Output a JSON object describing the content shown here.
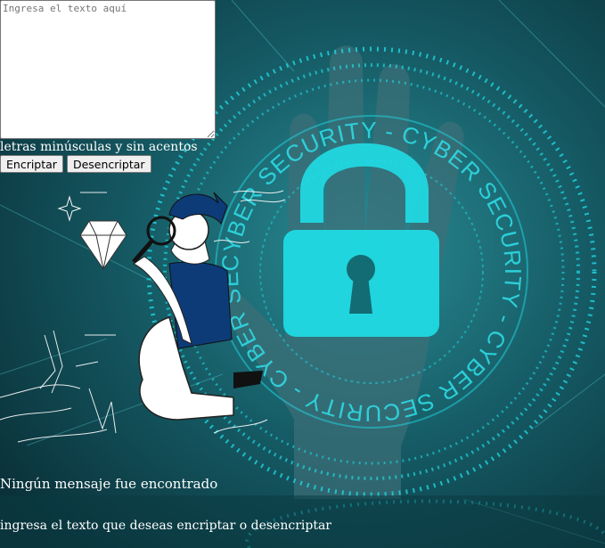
{
  "input": {
    "placeholder": "Ingresa el texto aquí",
    "value": ""
  },
  "hint": "letras minúsculas y sin acentos",
  "buttons": {
    "encrypt": "Encriptar",
    "decrypt": "Desencriptar"
  },
  "output": {
    "no_message_title": "Ningún mensaje fue encontrado",
    "instruction": "ingresa el texto que deseas encriptar o desencriptar"
  },
  "background": {
    "ring_text": "CYBER SECURITY - CYBER SECURITY - CYBER SECURITY - CYBER SECURITY -"
  },
  "colors": {
    "bg_dark": "#0d3f48",
    "accent_cyan": "#19d6df",
    "figure_blue": "#0d3b78"
  }
}
